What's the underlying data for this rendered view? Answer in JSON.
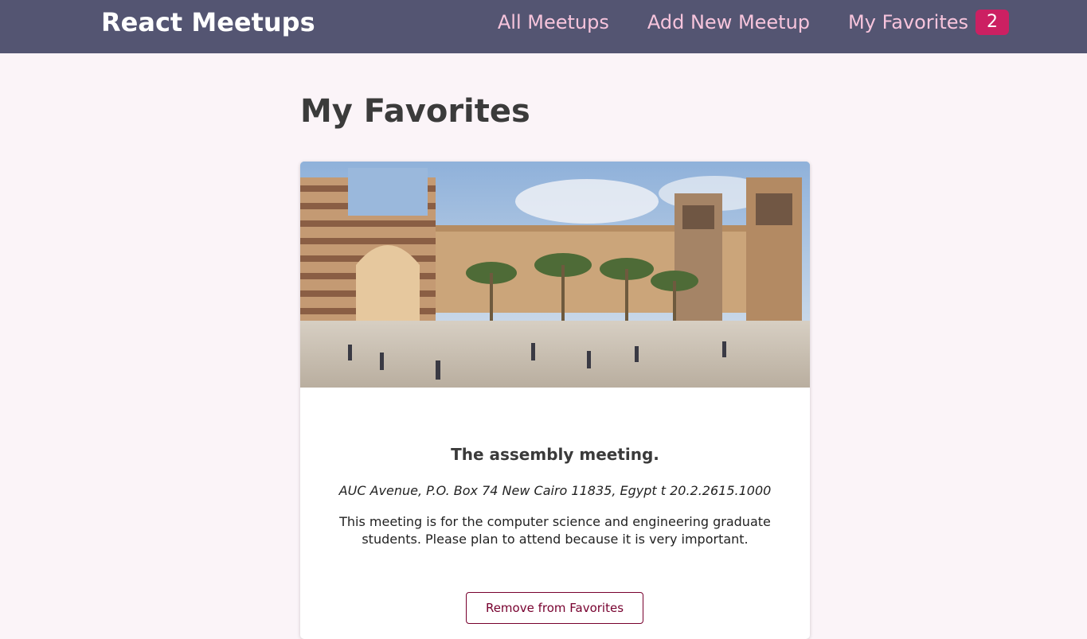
{
  "header": {
    "logo": "React Meetups",
    "nav": {
      "all_meetups": "All Meetups",
      "add_new_meetup": "Add New Meetup",
      "my_favorites": "My Favorites",
      "favorites_count": "2"
    }
  },
  "main": {
    "title": "My Favorites",
    "meetup": {
      "title": "The assembly meeting.",
      "address": "AUC Avenue, P.O. Box 74 New Cairo 11835, Egypt t 20.2.2615.1000",
      "description": "This meeting is for the computer science and engineering graduate students. Please plan to attend because it is very important.",
      "remove_label": "Remove from Favorites"
    }
  },
  "colors": {
    "header_bg": "#545572",
    "nav_link": "#f7c4dc",
    "badge_bg": "#cc2062",
    "page_bg": "#fbf4f8",
    "button_border": "#77002e"
  }
}
